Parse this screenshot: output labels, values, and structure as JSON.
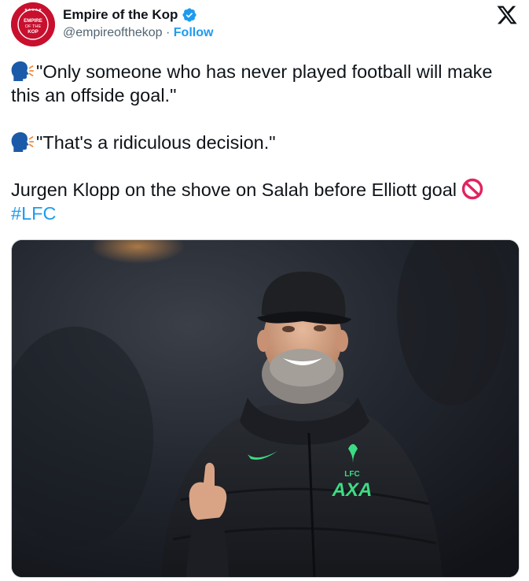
{
  "account": {
    "display_name": "Empire of the Kop",
    "handle": "@empireofthekop",
    "separator": "·",
    "follow_label": "Follow",
    "avatar_text": [
      "EMPIRE",
      "OF THE",
      "KOP"
    ],
    "verified": true,
    "brand_color": "#c8102e"
  },
  "platform_logo": "x-logo-icon",
  "tweet": {
    "paragraphs": [
      {
        "emoji": "speaking-head-icon",
        "text": "\"Only someone who has never played football will make this an offside goal.\""
      },
      {
        "emoji": "speaking-head-icon",
        "text": "\"That's a ridiculous decision.\""
      }
    ],
    "body_text": "Jurgen Klopp on the shove on Salah before Elliott goal",
    "trailing_emoji": "no-entry-icon",
    "hashtag": "#LFC"
  },
  "media": {
    "type": "photo",
    "shirt_text": [
      "LFC",
      "AXA"
    ],
    "accent_color": "#3ddc84"
  },
  "colors": {
    "text": "#0f1419",
    "secondary": "#536471",
    "link": "#1d9bf0",
    "verified": "#1d9bf0"
  }
}
